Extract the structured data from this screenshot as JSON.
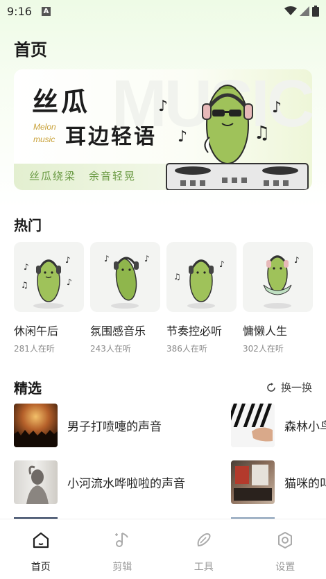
{
  "status_bar": {
    "time": "9:16",
    "notification_icon": "A"
  },
  "page": {
    "title": "首页"
  },
  "banner": {
    "title_line1": "丝瓜",
    "brand_line1": "Melon",
    "brand_line2": "music",
    "title_line2": "耳边轻语",
    "slogan_1": "丝瓜绕梁",
    "slogan_2": "余音轻晃",
    "watermark": "MUSIC"
  },
  "hot": {
    "title": "热门",
    "items": [
      {
        "name": "休闲午后",
        "count": "281人在听"
      },
      {
        "name": "氛围感音乐",
        "count": "243人在听"
      },
      {
        "name": "节奏控必听",
        "count": "386人在听"
      },
      {
        "name": "慵懒人生",
        "count": "302人在听"
      }
    ]
  },
  "featured": {
    "title": "精选",
    "refresh_label": "换一换",
    "items": [
      {
        "title": "男子打喷嚏的声音"
      },
      {
        "title": "森林小鸟"
      },
      {
        "title": "小河流水哗啦啦的声音"
      },
      {
        "title": "猫咪的叫"
      }
    ]
  },
  "nav": {
    "items": [
      {
        "label": "首页",
        "icon": "home-icon"
      },
      {
        "label": "剪辑",
        "icon": "music-note-icon"
      },
      {
        "label": "工具",
        "icon": "loofah-icon"
      },
      {
        "label": "设置",
        "icon": "settings-icon"
      }
    ]
  },
  "colors": {
    "accent_green": "#6a9a43",
    "background_tint": "#eefbe6"
  }
}
